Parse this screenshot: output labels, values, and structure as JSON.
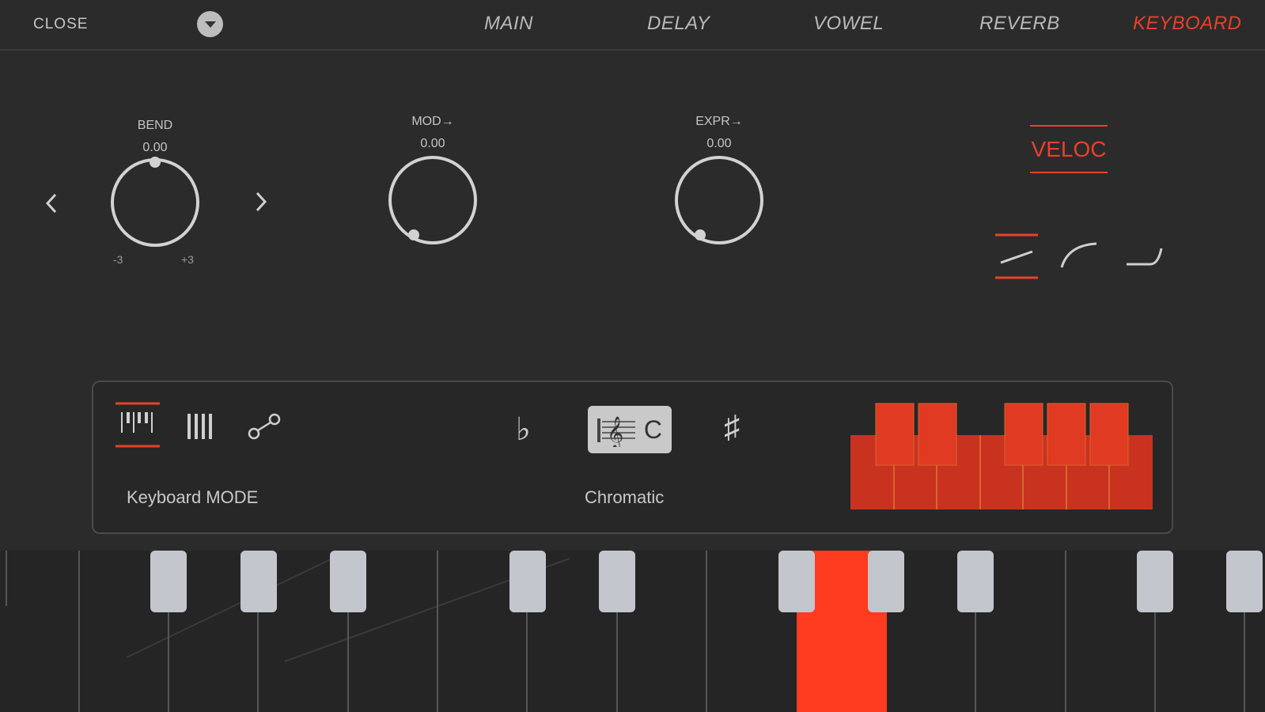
{
  "topbar": {
    "close_label": "CLOSE",
    "tabs": [
      "MAIN",
      "DELAY",
      "VOWEL",
      "REVERB",
      "KEYBOARD"
    ],
    "active_tab": "KEYBOARD"
  },
  "knobs": {
    "bend": {
      "label": "BEND",
      "value": "0.00",
      "min": "-3",
      "max": "+3"
    },
    "mod": {
      "label": "MOD→",
      "value": "0.00"
    },
    "expr": {
      "label": "EXPR→",
      "value": "0.00"
    }
  },
  "velocity": {
    "label": "VELOC",
    "curves": [
      "linear",
      "log",
      "exp"
    ],
    "selected_curve": "linear"
  },
  "keyboard_panel": {
    "mode_label": "Keyboard MODE",
    "modes": [
      "piano-keys",
      "bars",
      "glide"
    ],
    "selected_mode": "piano-keys",
    "flat_symbol": "♭",
    "sharp_symbol": "♯",
    "scale_root": "C",
    "scale_label": "Chromatic"
  },
  "colors": {
    "accent": "#e8412a",
    "background": "#2b2b2b",
    "key_active": "#ff3b1f"
  },
  "icons": [
    "chevron-left-icon",
    "chevron-right-icon",
    "chevron-down-icon",
    "flat-icon",
    "sharp-icon",
    "treble-clef-icon"
  ]
}
